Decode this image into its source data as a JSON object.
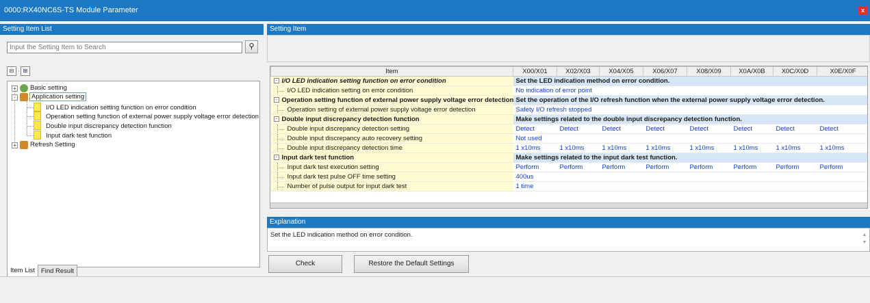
{
  "window": {
    "title": "0000:RX40NC6S-TS Module Parameter",
    "close_label": "x"
  },
  "left": {
    "header": "Setting Item List",
    "search": {
      "placeholder": "Input the Setting Item to Search",
      "value": ""
    },
    "search_icon": "binoculars-icon",
    "tree_tool_icons": [
      "collapse-all-icon",
      "expand-all-icon"
    ],
    "tree": {
      "basic": {
        "label": "Basic setting",
        "expander": "+"
      },
      "application": {
        "label": "Application setting",
        "expander": "-"
      },
      "children": [
        "I/O LED indication setting function on error condition",
        "Operation setting function of external power supply voltage error detection",
        "Double input discrepancy detection function",
        "Input dark test function"
      ],
      "refresh": {
        "label": "Refresh Setting",
        "expander": "+"
      }
    },
    "tabs": [
      "Item List",
      "Find Result"
    ]
  },
  "right": {
    "header": "Setting Item",
    "grid": {
      "item_header": "Item",
      "columns": [
        "X00/X01",
        "X02/X03",
        "X04/X05",
        "X06/X07",
        "X08/X09",
        "X0A/X0B",
        "X0C/X0D",
        "X0E/X0F"
      ],
      "rows": [
        {
          "type": "cat",
          "label": "I/O LED indication setting function on error condition",
          "italic": true,
          "desc": "Set the LED indication method on error condition."
        },
        {
          "type": "sub",
          "label": "I/O LED indication setting on error condition",
          "single": "No indication of error point"
        },
        {
          "type": "cat",
          "label": "Operation setting function of external power supply voltage error detection",
          "desc": "Set the operation of the I/O refresh function when the external power supply voltage error detection."
        },
        {
          "type": "sub",
          "label": "Operation setting of external power supply voltage error detection",
          "single": "Safety I/O refresh stopped"
        },
        {
          "type": "cat",
          "label": "Double input discrepancy detection function",
          "desc": "Make settings related to the double input discrepancy detection function."
        },
        {
          "type": "sub",
          "label": "Double input discrepancy detection setting",
          "values": [
            "Detect",
            "Detect",
            "Detect",
            "Detect",
            "Detect",
            "Detect",
            "Detect",
            "Detect"
          ]
        },
        {
          "type": "sub",
          "label": "Double input discrepancy auto recovery setting",
          "single": "Not used"
        },
        {
          "type": "sub",
          "label": "Double input discrepancy detection time",
          "values": [
            "1 x10ms",
            "1 x10ms",
            "1 x10ms",
            "1 x10ms",
            "1 x10ms",
            "1 x10ms",
            "1 x10ms",
            "1 x10ms"
          ]
        },
        {
          "type": "cat",
          "label": "Input dark test function",
          "desc": "Make settings related to the input dark test function."
        },
        {
          "type": "sub",
          "label": "Input dark test execution setting",
          "values": [
            "Perform",
            "Perform",
            "Perform",
            "Perform",
            "Perform",
            "Perform",
            "Perform",
            "Perform"
          ]
        },
        {
          "type": "sub",
          "label": "Input dark test pulse OFF time setting",
          "single": "400us"
        },
        {
          "type": "sub",
          "label": "Number of pulse output for input dark test",
          "single": "1 time"
        }
      ]
    },
    "explanation": {
      "header": "Explanation",
      "text": "Set the LED indication method on error condition."
    },
    "buttons": {
      "check": "Check",
      "restore": "Restore the Default Settings"
    }
  },
  "colors": {
    "accent": "#1d79c3",
    "item_bg": "#fffbd0",
    "category_desc_bg": "#d6e6f7",
    "value_text": "#1340c8"
  }
}
